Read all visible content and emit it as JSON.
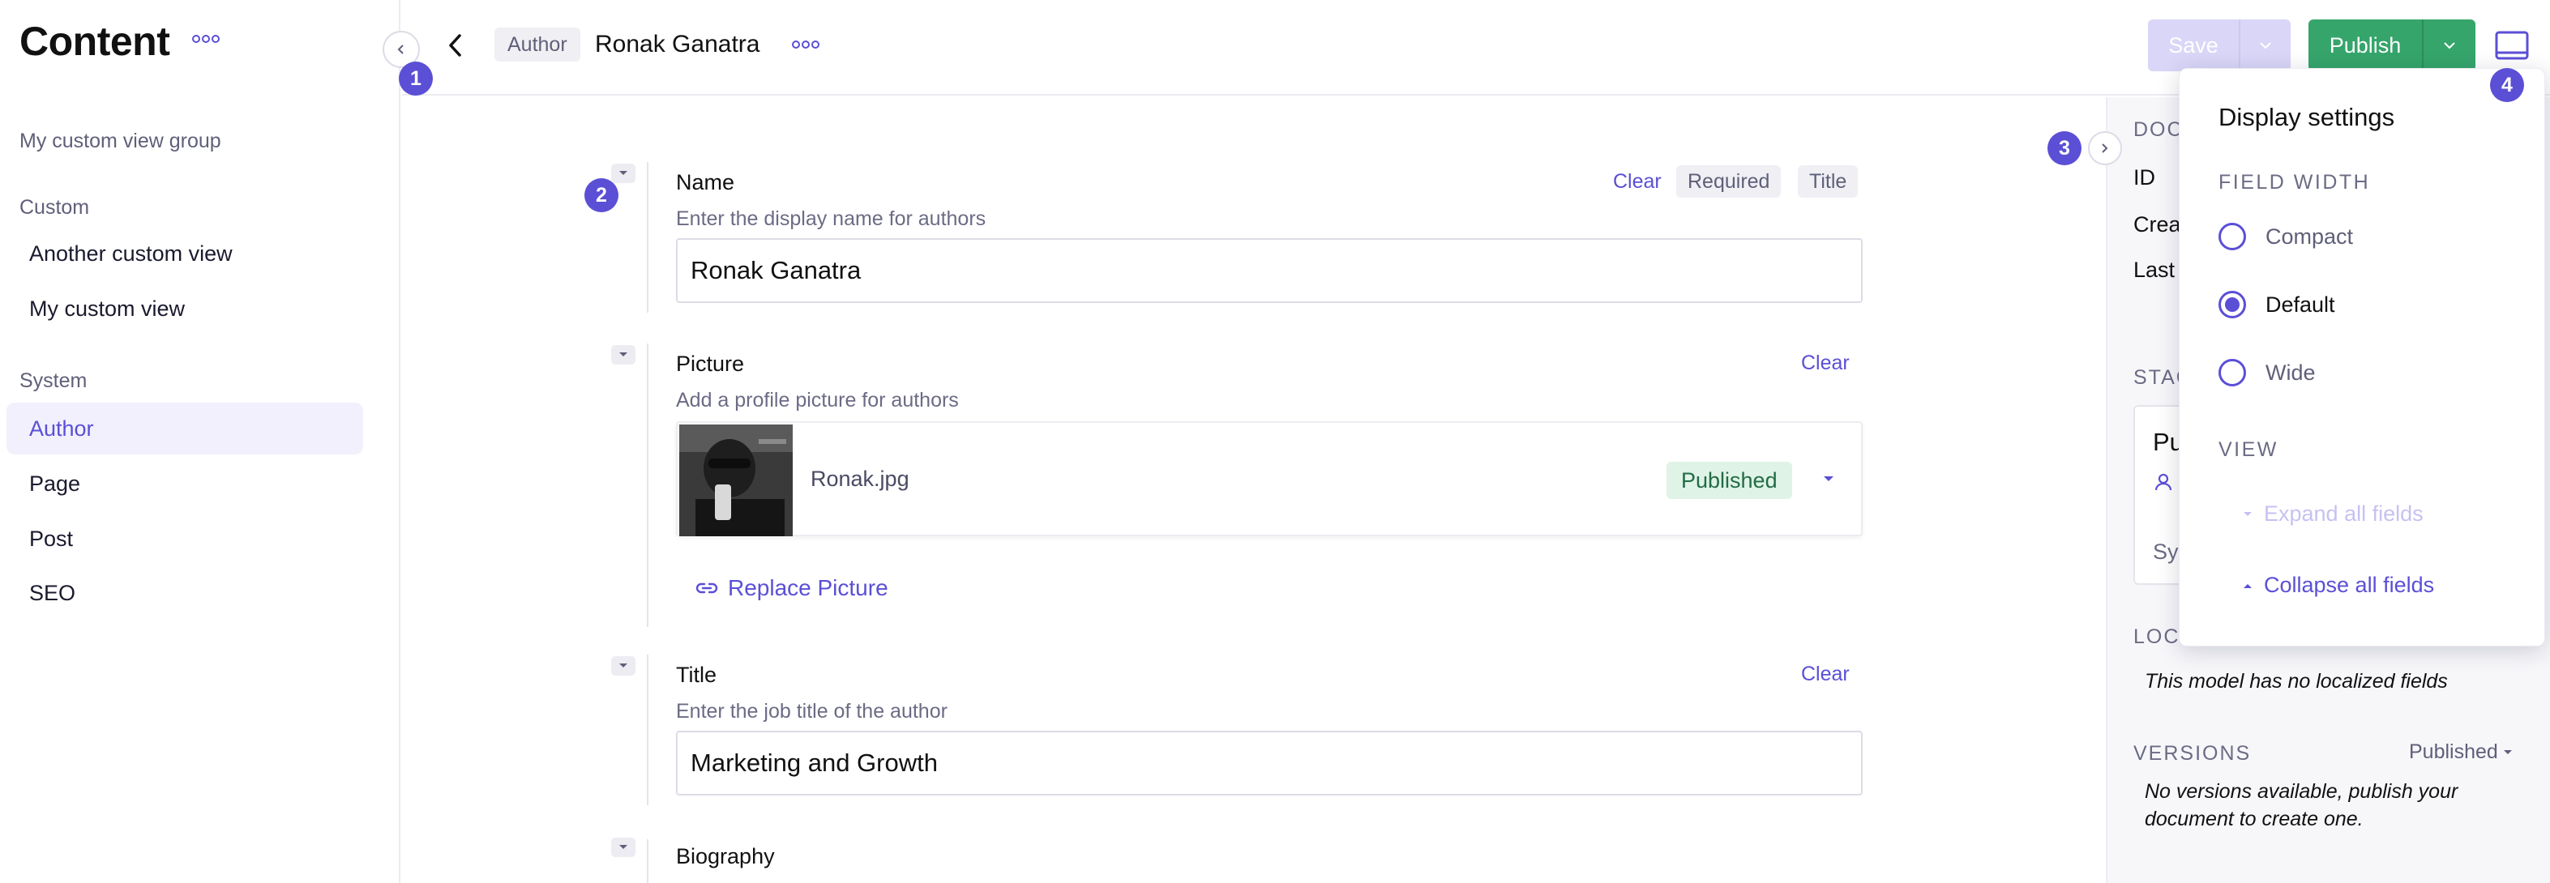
{
  "sidebar": {
    "title": "Content",
    "group_header": "My custom view group",
    "sections": [
      {
        "label": "Custom",
        "items": [
          "Another custom view",
          "My custom view"
        ]
      },
      {
        "label": "System",
        "items": [
          "Author",
          "Page",
          "Post",
          "SEO"
        ]
      }
    ]
  },
  "header": {
    "model_badge": "Author",
    "document_title": "Ronak Ganatra",
    "save_label": "Save",
    "publish_label": "Publish"
  },
  "markers": [
    "1",
    "2",
    "3",
    "4"
  ],
  "form": {
    "name": {
      "label": "Name",
      "description": "Enter the display name for authors",
      "value": "Ronak Ganatra",
      "clear": "Clear",
      "tags": [
        "Required",
        "Title"
      ]
    },
    "picture": {
      "label": "Picture",
      "description": "Add a profile picture for authors",
      "clear": "Clear",
      "file_name": "Ronak.jpg",
      "status": "Published",
      "replace_label": "Replace Picture"
    },
    "title": {
      "label": "Title",
      "description": "Enter the job title of the author",
      "value": "Marketing and Growth",
      "clear": "Clear"
    },
    "biography": {
      "label": "Biography"
    }
  },
  "info_panel": {
    "document_header": "DOC",
    "rows": [
      "ID",
      "Crea",
      "Last"
    ],
    "stage_header": "STAG",
    "stage_title": "Pu",
    "stage_sub": "Sy",
    "localization_header": "LOC",
    "localization_note": "This model has no localized fields",
    "versions_header": "VERSIONS",
    "versions_filter": "Published",
    "versions_note": "No versions available, publish your document to create one."
  },
  "display_settings": {
    "title": "Display settings",
    "field_width_header": "FIELD WIDTH",
    "options": [
      {
        "label": "Compact",
        "selected": false
      },
      {
        "label": "Default",
        "selected": true
      },
      {
        "label": "Wide",
        "selected": false
      }
    ],
    "view_header": "VIEW",
    "expand_label": "Expand all fields",
    "collapse_label": "Collapse all fields"
  },
  "colors": {
    "accent": "#5b4fd6",
    "publish": "#35a56b",
    "save_disabled": "#d9d6f7",
    "published_badge_bg": "#dff3e6"
  }
}
